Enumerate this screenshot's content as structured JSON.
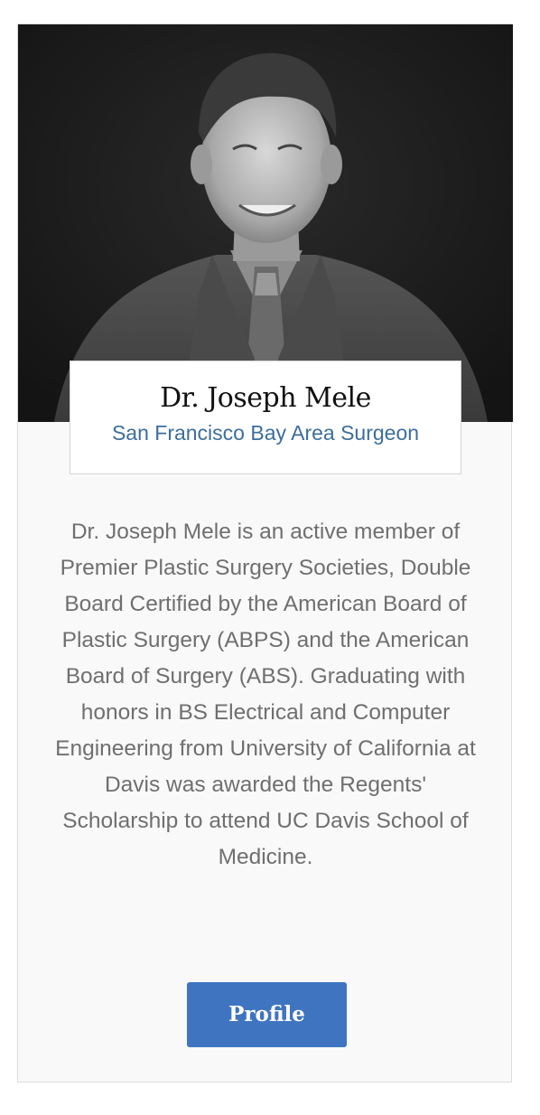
{
  "card": {
    "photo_alt": "portrait",
    "name": "Dr. Joseph Mele",
    "subtitle": "San Francisco Bay Area Surgeon",
    "bio": "Dr. Joseph Mele is an active member of Premier Plastic Surgery Societies, Double Board Certified by the American Board of Plastic Surgery (ABPS) and the American Board of Surgery (ABS). Graduating with honors in BS Electrical and Computer Engineering from University of California at Davis was awarded the Regents' Scholarship to attend UC Davis School of Medicine.",
    "button_label": "Profile"
  },
  "colors": {
    "link": "#3c6e9e",
    "button": "#3f74c0",
    "body_text": "#6f6f6f"
  }
}
